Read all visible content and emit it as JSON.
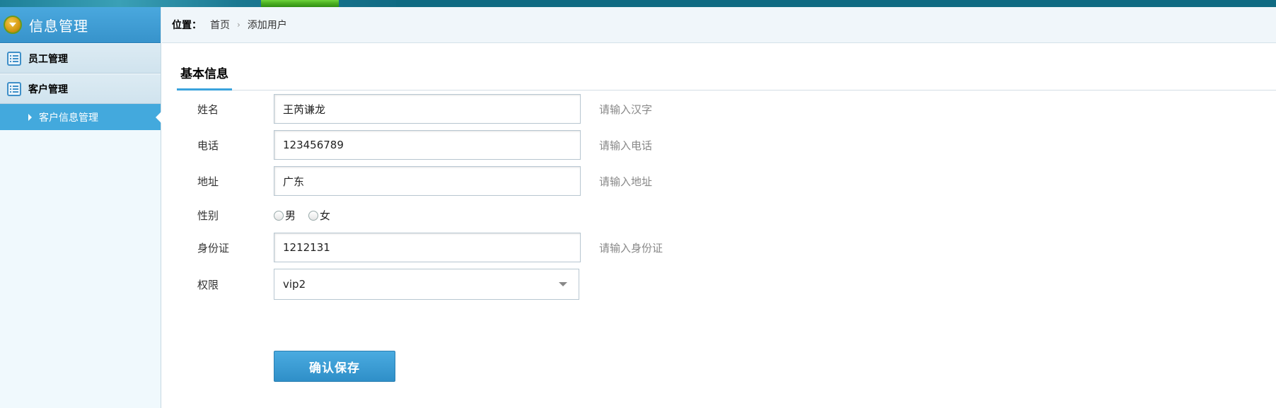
{
  "sidebar": {
    "title": "信息管理",
    "items": [
      {
        "label": "员工管理",
        "icon": "list-icon"
      },
      {
        "label": "客户管理",
        "icon": "list-icon"
      }
    ],
    "active_sub": {
      "label": "客户信息管理"
    }
  },
  "breadcrumb": {
    "prefix": "位置：",
    "home": "首页",
    "separator": "›",
    "current": "添加用户"
  },
  "tabs": [
    {
      "label": "基本信息"
    }
  ],
  "form": {
    "name": {
      "label": "姓名",
      "value": "王芮谦龙",
      "hint": "请输入汉字"
    },
    "phone": {
      "label": "电话",
      "value": "123456789",
      "hint": "请输入电话"
    },
    "address": {
      "label": "地址",
      "value": "广东",
      "hint": "请输入地址"
    },
    "gender": {
      "label": "性别",
      "options": [
        "男",
        "女"
      ]
    },
    "id_card": {
      "label": "身份证",
      "value": "1212131",
      "hint": "请输入身份证"
    },
    "permission": {
      "label": "权限",
      "value": "vip2"
    },
    "submit_label": "确认保存"
  },
  "colors": {
    "accent": "#3aa3dc",
    "sidebar_active": "#43a9dd",
    "topbar": "#0f6a82"
  }
}
